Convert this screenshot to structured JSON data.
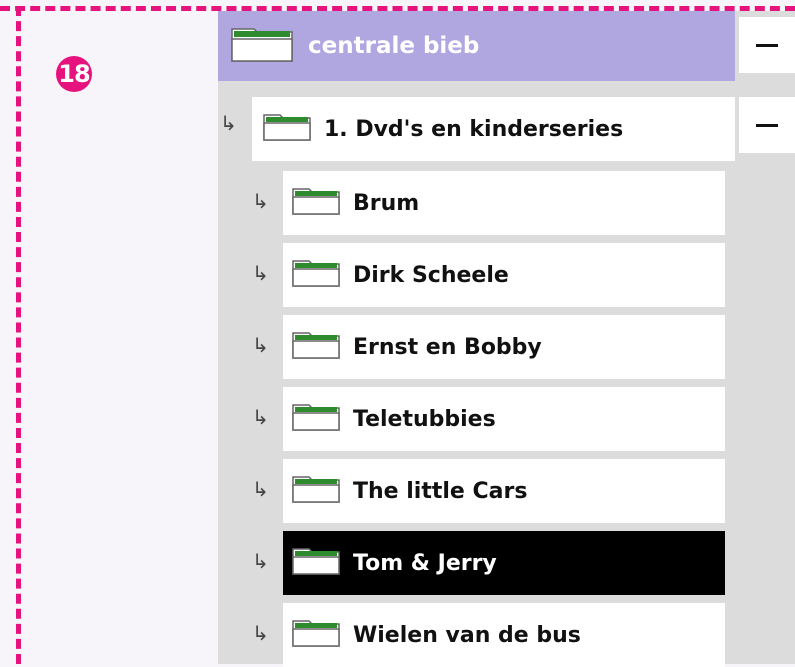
{
  "step_badge": "18",
  "tree": {
    "root": {
      "label": "centrale bieb",
      "collapse_symbol": "−"
    },
    "level1": {
      "label": "1. Dvd's en kinderseries",
      "collapse_symbol": "−"
    },
    "items": [
      {
        "label": "Brum",
        "selected": false
      },
      {
        "label": "Dirk Scheele",
        "selected": false
      },
      {
        "label": "Ernst en Bobby",
        "selected": false
      },
      {
        "label": "Teletubbies",
        "selected": false
      },
      {
        "label": "The little Cars",
        "selected": false
      },
      {
        "label": "Tom & Jerry",
        "selected": true
      },
      {
        "label": "Wielen van de bus",
        "selected": false
      }
    ],
    "child_arrow": "↳"
  },
  "colors": {
    "frame": "#e6137e",
    "root_background": "#b0a7e0",
    "folder_tab": "#2e8b2e",
    "selected_background": "#000000"
  }
}
